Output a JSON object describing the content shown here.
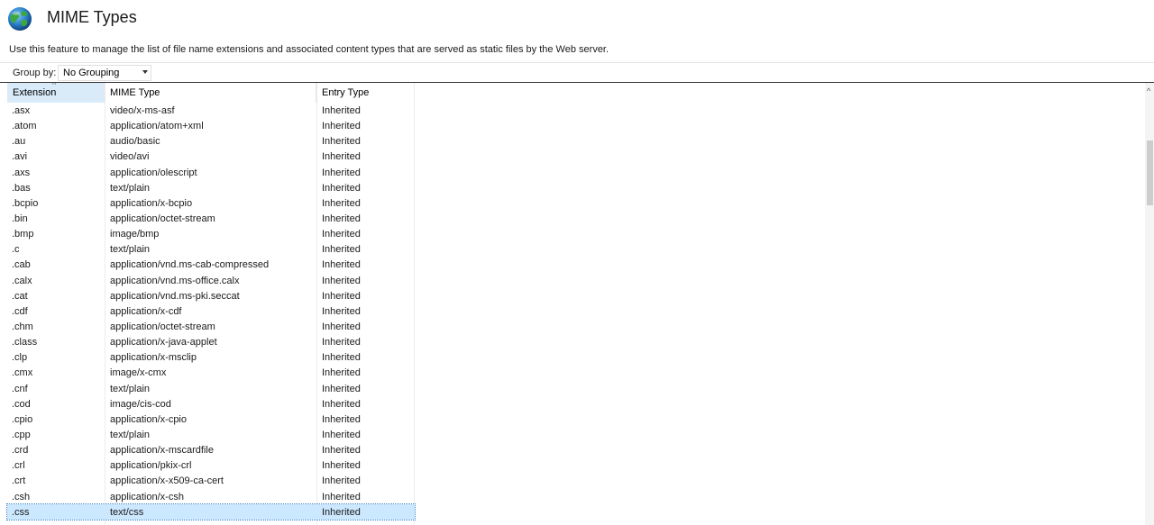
{
  "header": {
    "title": "MIME Types",
    "description": "Use this feature to manage the list of file name extensions and associated content types that are served as static files by the Web server.",
    "icon": "globe-icon"
  },
  "toolbar": {
    "group_by_label": "Group by:",
    "group_by_value": "No Grouping"
  },
  "list": {
    "columns": [
      "Extension",
      "MIME Type",
      "Entry Type"
    ],
    "rows": [
      {
        "ext": ".asx",
        "mime": "video/x-ms-asf",
        "entry": "Inherited"
      },
      {
        "ext": ".atom",
        "mime": "application/atom+xml",
        "entry": "Inherited"
      },
      {
        "ext": ".au",
        "mime": "audio/basic",
        "entry": "Inherited"
      },
      {
        "ext": ".avi",
        "mime": "video/avi",
        "entry": "Inherited"
      },
      {
        "ext": ".axs",
        "mime": "application/olescript",
        "entry": "Inherited"
      },
      {
        "ext": ".bas",
        "mime": "text/plain",
        "entry": "Inherited"
      },
      {
        "ext": ".bcpio",
        "mime": "application/x-bcpio",
        "entry": "Inherited"
      },
      {
        "ext": ".bin",
        "mime": "application/octet-stream",
        "entry": "Inherited"
      },
      {
        "ext": ".bmp",
        "mime": "image/bmp",
        "entry": "Inherited"
      },
      {
        "ext": ".c",
        "mime": "text/plain",
        "entry": "Inherited"
      },
      {
        "ext": ".cab",
        "mime": "application/vnd.ms-cab-compressed",
        "entry": "Inherited"
      },
      {
        "ext": ".calx",
        "mime": "application/vnd.ms-office.calx",
        "entry": "Inherited"
      },
      {
        "ext": ".cat",
        "mime": "application/vnd.ms-pki.seccat",
        "entry": "Inherited"
      },
      {
        "ext": ".cdf",
        "mime": "application/x-cdf",
        "entry": "Inherited"
      },
      {
        "ext": ".chm",
        "mime": "application/octet-stream",
        "entry": "Inherited"
      },
      {
        "ext": ".class",
        "mime": "application/x-java-applet",
        "entry": "Inherited"
      },
      {
        "ext": ".clp",
        "mime": "application/x-msclip",
        "entry": "Inherited"
      },
      {
        "ext": ".cmx",
        "mime": "image/x-cmx",
        "entry": "Inherited"
      },
      {
        "ext": ".cnf",
        "mime": "text/plain",
        "entry": "Inherited"
      },
      {
        "ext": ".cod",
        "mime": "image/cis-cod",
        "entry": "Inherited"
      },
      {
        "ext": ".cpio",
        "mime": "application/x-cpio",
        "entry": "Inherited"
      },
      {
        "ext": ".cpp",
        "mime": "text/plain",
        "entry": "Inherited"
      },
      {
        "ext": ".crd",
        "mime": "application/x-mscardfile",
        "entry": "Inherited"
      },
      {
        "ext": ".crl",
        "mime": "application/pkix-crl",
        "entry": "Inherited"
      },
      {
        "ext": ".crt",
        "mime": "application/x-x509-ca-cert",
        "entry": "Inherited"
      },
      {
        "ext": ".csh",
        "mime": "application/x-csh",
        "entry": "Inherited"
      },
      {
        "ext": ".css",
        "mime": "text/css",
        "entry": "Inherited",
        "selected": true
      }
    ]
  },
  "colors": {
    "sorted_header_bg": "#d9ebf9",
    "selected_row_bg": "#cce8ff"
  }
}
